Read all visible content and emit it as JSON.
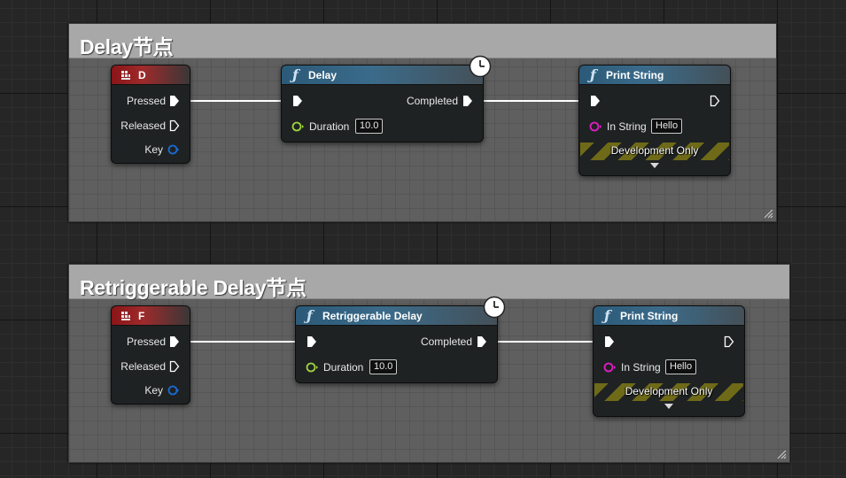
{
  "comments": [
    {
      "title": "Delay节点",
      "key_node": {
        "key": "D",
        "pins": [
          "Pressed",
          "Released",
          "Key"
        ]
      },
      "delay_node": {
        "title": "Delay",
        "exec_out": "Completed",
        "duration_label": "Duration",
        "duration_value": "10.0"
      },
      "print_node": {
        "title": "Print String",
        "in_string_label": "In String",
        "in_string_value": "Hello",
        "dev_label": "Development Only"
      }
    },
    {
      "title": "Retriggerable Delay节点",
      "key_node": {
        "key": "F",
        "pins": [
          "Pressed",
          "Released",
          "Key"
        ]
      },
      "delay_node": {
        "title": "Retriggerable Delay",
        "exec_out": "Completed",
        "duration_label": "Duration",
        "duration_value": "10.0"
      },
      "print_node": {
        "title": "Print String",
        "in_string_label": "In String",
        "in_string_value": "Hello",
        "dev_label": "Development Only"
      }
    }
  ],
  "colors": {
    "exec_pin": "#ffffff",
    "float_pin": "#9ed43f",
    "string_pin": "#e21ec7",
    "key_pin": "#1a6ad6",
    "event_header": "#8a1417",
    "function_header": "#2b5a78"
  },
  "icons": {
    "function": "function-icon",
    "key": "keyboard-icon",
    "latent": "clock-icon"
  }
}
